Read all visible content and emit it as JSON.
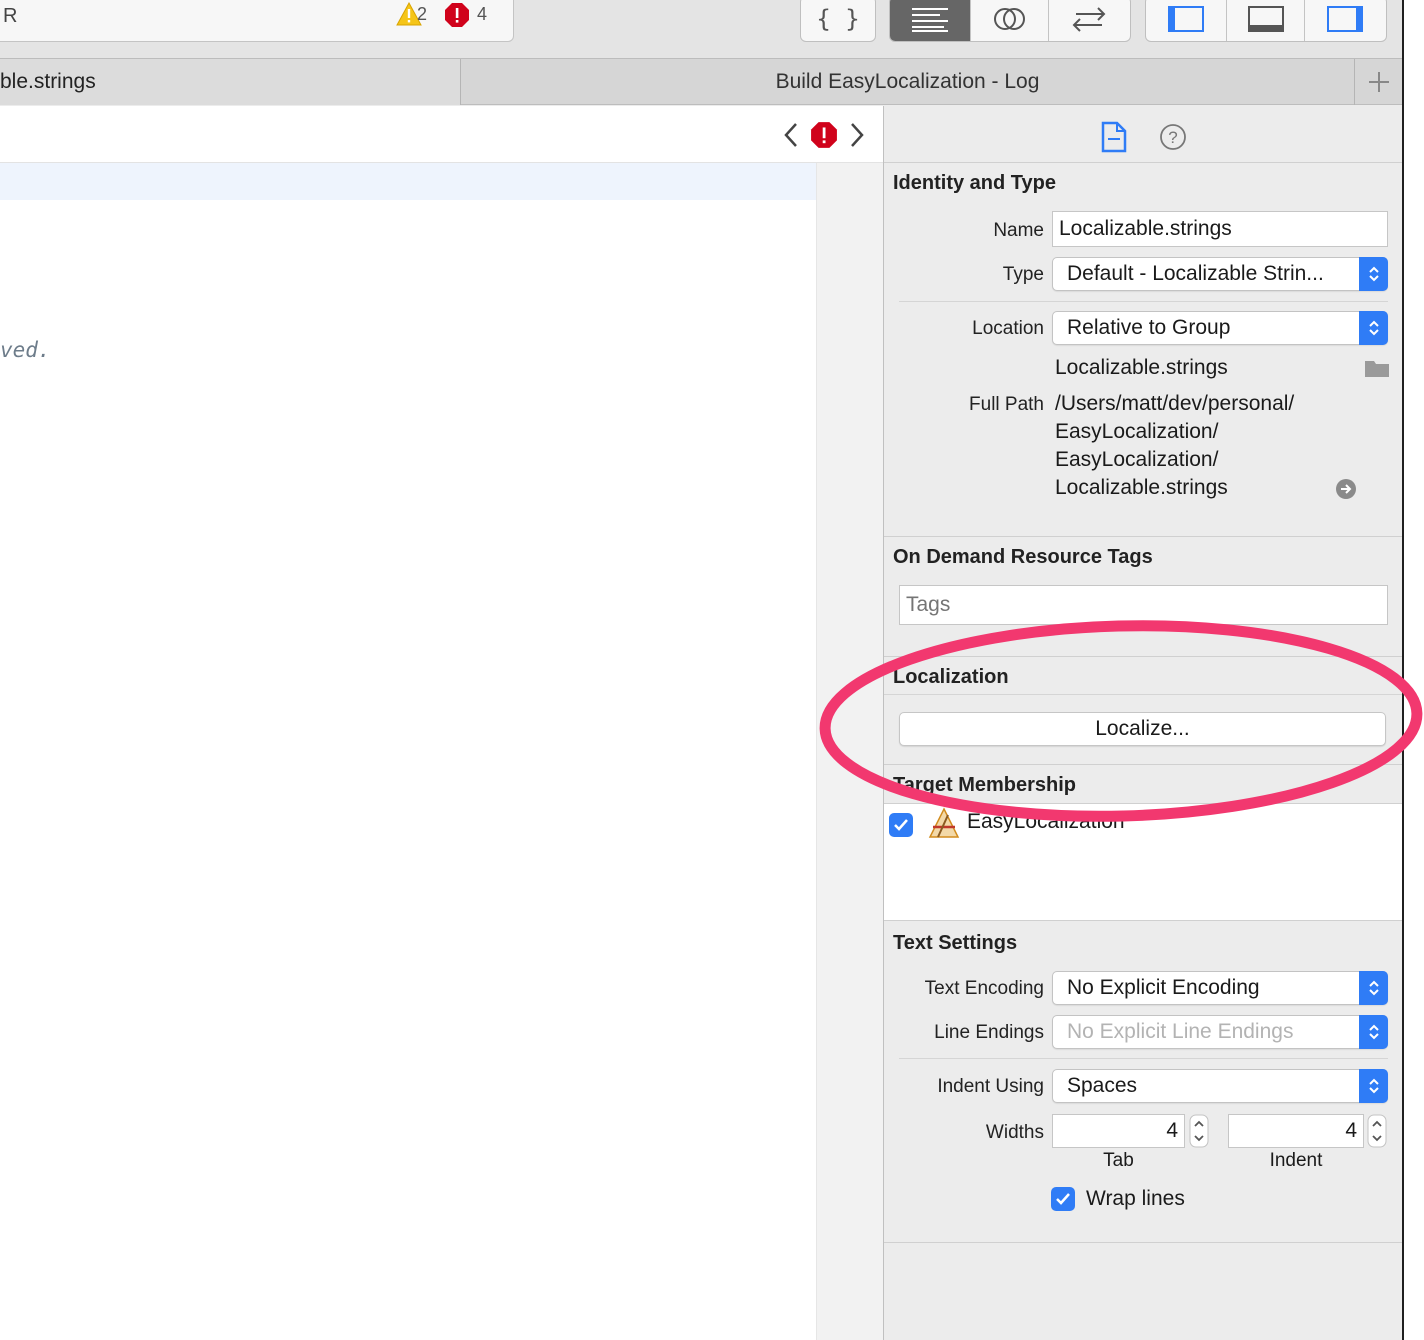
{
  "toolbar": {
    "activity_left_text": "R",
    "warnings_count": "2",
    "errors_count": "4"
  },
  "tabs": {
    "left_label": "ble.strings",
    "right_label": "Build EasyLocalization - Log",
    "add_label": "+"
  },
  "editor": {
    "code_fragment": "ved."
  },
  "inspector": {
    "identity": {
      "title": "Identity and Type",
      "name_label": "Name",
      "name_value": "Localizable.strings",
      "type_label": "Type",
      "type_value": "Default - Localizable Strin...",
      "location_label": "Location",
      "location_value": "Relative to Group",
      "location_file": "Localizable.strings",
      "full_path_label": "Full Path",
      "full_path_lines": [
        "/Users/matt/dev/personal/",
        "EasyLocalization/",
        "EasyLocalization/",
        "Localizable.strings"
      ]
    },
    "odr": {
      "title": "On Demand Resource Tags",
      "tags_placeholder": "Tags"
    },
    "localization": {
      "title": "Localization",
      "button_label": "Localize..."
    },
    "membership": {
      "title": "Target Membership",
      "target_name": "EasyLocalization",
      "checked": true
    },
    "text_settings": {
      "title": "Text Settings",
      "encoding_label": "Text Encoding",
      "encoding_value": "No Explicit Encoding",
      "line_endings_label": "Line Endings",
      "line_endings_value": "No Explicit Line Endings",
      "indent_using_label": "Indent Using",
      "indent_using_value": "Spaces",
      "widths_label": "Widths",
      "tab_value": "4",
      "indent_value": "4",
      "tab_caption": "Tab",
      "indent_caption": "Indent",
      "wrap_lines_label": "Wrap lines",
      "wrap_lines_checked": true
    }
  },
  "colors": {
    "accent": "#2f7cf6",
    "annotation": "#f2386f",
    "error": "#d0021b",
    "warning": "#f5c518"
  }
}
